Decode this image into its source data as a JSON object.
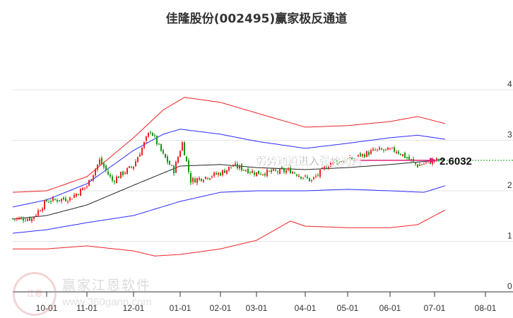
{
  "chart_data": {
    "type": "candlestick-channel",
    "title": "佳隆股份(002495)赢家极反通道",
    "ylim": [
      0,
      4
    ],
    "yticks": [
      0,
      1,
      2,
      3,
      4
    ],
    "xticks": [
      {
        "label": "10-01",
        "day": 16
      },
      {
        "label": "11-01",
        "day": 35
      },
      {
        "label": "12-01",
        "day": 57
      },
      {
        "label": "01-01",
        "day": 79
      },
      {
        "label": "02-01",
        "day": 98
      },
      {
        "label": "03-01",
        "day": 115
      },
      {
        "label": "04-01",
        "day": 138
      },
      {
        "label": "05-01",
        "day": 158
      },
      {
        "label": "06-01",
        "day": 178
      },
      {
        "label": "07-01",
        "day": 199
      },
      {
        "label": "08-01",
        "day": 223
      }
    ],
    "close_path": [
      [
        0,
        1.45
      ],
      [
        9,
        1.45
      ],
      [
        16,
        1.8
      ],
      [
        27,
        1.85
      ],
      [
        35,
        2.1
      ],
      [
        41,
        2.6
      ],
      [
        47,
        2.2
      ],
      [
        57,
        2.5
      ],
      [
        65,
        3.2
      ],
      [
        71,
        2.7
      ],
      [
        76,
        2.4
      ],
      [
        80,
        2.95
      ],
      [
        84,
        2.2
      ],
      [
        98,
        2.35
      ],
      [
        104,
        2.5
      ],
      [
        115,
        2.35
      ],
      [
        131,
        2.4
      ],
      [
        141,
        2.2
      ],
      [
        151,
        2.6
      ],
      [
        158,
        2.6
      ],
      [
        171,
        2.8
      ],
      [
        181,
        2.8
      ],
      [
        191,
        2.5
      ],
      [
        199,
        2.6
      ],
      [
        201,
        2.6
      ]
    ],
    "series": [
      {
        "name": "mid",
        "color": "#222222",
        "points": [
          [
            0,
            1.44
          ],
          [
            16,
            1.51
          ],
          [
            35,
            1.72
          ],
          [
            57,
            2.11
          ],
          [
            79,
            2.49
          ],
          [
            98,
            2.52
          ],
          [
            115,
            2.46
          ],
          [
            138,
            2.42
          ],
          [
            158,
            2.46
          ],
          [
            178,
            2.52
          ],
          [
            199,
            2.6
          ],
          [
            204,
            2.62
          ]
        ]
      },
      {
        "name": "inner-upper",
        "color": "#2b2bff",
        "points": [
          [
            0,
            1.68
          ],
          [
            16,
            1.82
          ],
          [
            35,
            2.14
          ],
          [
            57,
            2.8
          ],
          [
            71,
            3.12
          ],
          [
            79,
            3.22
          ],
          [
            98,
            3.12
          ],
          [
            115,
            2.98
          ],
          [
            138,
            2.84
          ],
          [
            158,
            2.94
          ],
          [
            178,
            3.05
          ],
          [
            191,
            3.1
          ],
          [
            204,
            3.02
          ]
        ]
      },
      {
        "name": "inner-lower",
        "color": "#2b2bff",
        "points": [
          [
            0,
            1.16
          ],
          [
            16,
            1.23
          ],
          [
            35,
            1.37
          ],
          [
            57,
            1.51
          ],
          [
            79,
            1.79
          ],
          [
            98,
            1.97
          ],
          [
            115,
            2.0
          ],
          [
            138,
            2.0
          ],
          [
            158,
            2.03
          ],
          [
            178,
            2.0
          ],
          [
            194,
            1.97
          ],
          [
            204,
            2.1
          ]
        ]
      },
      {
        "name": "outer-upper",
        "color": "#ee2222",
        "points": [
          [
            0,
            1.97
          ],
          [
            16,
            2.0
          ],
          [
            35,
            2.28
          ],
          [
            57,
            3.05
          ],
          [
            71,
            3.6
          ],
          [
            81,
            3.85
          ],
          [
            98,
            3.75
          ],
          [
            115,
            3.54
          ],
          [
            138,
            3.26
          ],
          [
            158,
            3.29
          ],
          [
            178,
            3.37
          ],
          [
            191,
            3.47
          ],
          [
            204,
            3.33
          ]
        ]
      },
      {
        "name": "outer-lower",
        "color": "#ee2222",
        "points": [
          [
            0,
            0.85
          ],
          [
            16,
            0.85
          ],
          [
            35,
            0.91
          ],
          [
            57,
            0.81
          ],
          [
            67,
            0.71
          ],
          [
            79,
            0.74
          ],
          [
            98,
            0.85
          ],
          [
            115,
            1.02
          ],
          [
            131,
            1.4
          ],
          [
            138,
            1.3
          ],
          [
            158,
            1.27
          ],
          [
            178,
            1.27
          ],
          [
            191,
            1.33
          ],
          [
            204,
            1.62
          ]
        ]
      }
    ],
    "current_price": {
      "value": 2.6032,
      "label": "2.6032"
    },
    "annotation": "弱势通道进入强势通道",
    "colors": {
      "up": "#ee2222",
      "down": "#119911",
      "arrow": "#e0207a"
    }
  },
  "watermark": {
    "name": "赢家江恩软件",
    "url": "www.360gann.com",
    "seal": "江恩"
  }
}
